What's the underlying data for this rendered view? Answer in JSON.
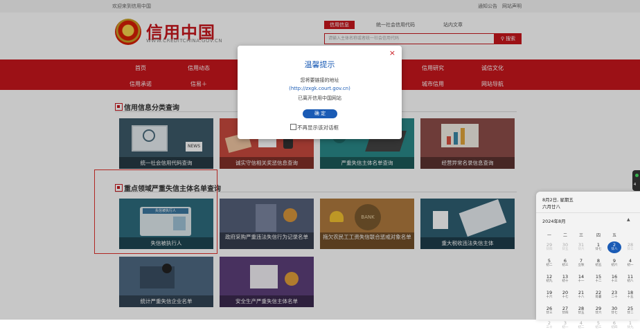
{
  "topbar": {
    "welcome": "欢迎来到信用中国",
    "links": [
      "通知公告",
      "网站声明"
    ]
  },
  "logo": {
    "title": "信用中国",
    "url": "WWW.CREDITCHINA.GOV.CN"
  },
  "search": {
    "tabs": [
      "信用信息",
      "统一社会信用代码",
      "站内文章"
    ],
    "placeholder": "请输入主体名称或者统一社会信用代码",
    "button": "搜索"
  },
  "nav": {
    "row1": [
      "首页",
      "信用动态",
      "信用研究",
      "诚信文化"
    ],
    "row2": [
      "信用承诺",
      "信易＋",
      "城市信用",
      "网站导航"
    ]
  },
  "section1": {
    "title": "信用信息分类查询",
    "cards": [
      "统一社会信用代码查询",
      "诚实守信相关奖惩信息查询",
      "严重失信主体名单查询",
      "经营异常名录信息查询"
    ]
  },
  "section2": {
    "title": "重点领域严重失信主体名单查询",
    "cards": [
      "失信被执行人",
      "政府采购严重违法失信行为记录名单",
      "拖欠农民工工资失信联合惩戒对象名单",
      "重大税收违法失信主体",
      "统计严重失信企业名单",
      "安全生产严重失信主体名单"
    ]
  },
  "illustration_text": {
    "news": "NEWS",
    "bank": "BANK",
    "sign": "失信被执行人"
  },
  "modal": {
    "title": "温馨提示",
    "close": "×",
    "line1": "您将要链接的地址",
    "url": "(http://zxgk.court.gov.cn)",
    "line3": "已离开信用中国网站",
    "ok": "确 定",
    "checkbox": "不再显示该对话框"
  },
  "calendar": {
    "date": "8月2日, 星期五",
    "lunar": "六月廿八",
    "month": "2024年8月",
    "weekdays": [
      "一",
      "二",
      "三",
      "四",
      "五"
    ],
    "rows": [
      [
        [
          "29",
          "廿四",
          1
        ],
        [
          "30",
          "廿五",
          1
        ],
        [
          "31",
          "廿六",
          1
        ],
        [
          "1",
          "廿七",
          0
        ],
        [
          "2",
          "廿八",
          2
        ]
      ],
      [
        [
          "5",
          "初二",
          0
        ],
        [
          "6",
          "初三",
          0
        ],
        [
          "7",
          "立秋",
          0
        ],
        [
          "8",
          "初五",
          0
        ],
        [
          "9",
          "初六",
          0
        ]
      ],
      [
        [
          "12",
          "初九",
          0
        ],
        [
          "13",
          "初十",
          0
        ],
        [
          "14",
          "十一",
          0
        ],
        [
          "15",
          "十二",
          0
        ],
        [
          "16",
          "十三",
          0
        ]
      ],
      [
        [
          "19",
          "十六",
          0
        ],
        [
          "20",
          "十七",
          0
        ],
        [
          "21",
          "十八",
          0
        ],
        [
          "22",
          "处暑",
          0
        ],
        [
          "23",
          "二十",
          0
        ]
      ],
      [
        [
          "26",
          "廿三",
          0
        ],
        [
          "27",
          "廿四",
          0
        ],
        [
          "28",
          "廿五",
          0
        ],
        [
          "29",
          "廿六",
          0
        ],
        [
          "30",
          "廿七",
          0
        ]
      ],
      [
        [
          "2",
          "三十",
          1
        ],
        [
          "3",
          "初一",
          1
        ],
        [
          "4",
          "初二",
          1
        ],
        [
          "5",
          "初三",
          1
        ],
        [
          "6",
          "初四",
          1
        ]
      ]
    ],
    "edge_rows": [
      [
        "28",
        "廿三",
        1
      ],
      [
        "4",
        "初一",
        0
      ],
      [
        "11",
        "初八",
        0
      ],
      [
        "18",
        "十五",
        0
      ],
      [
        "25",
        "廿二",
        0
      ],
      [
        "1",
        "廿九",
        1
      ]
    ]
  },
  "edge_widget": {
    "temp": "4"
  }
}
